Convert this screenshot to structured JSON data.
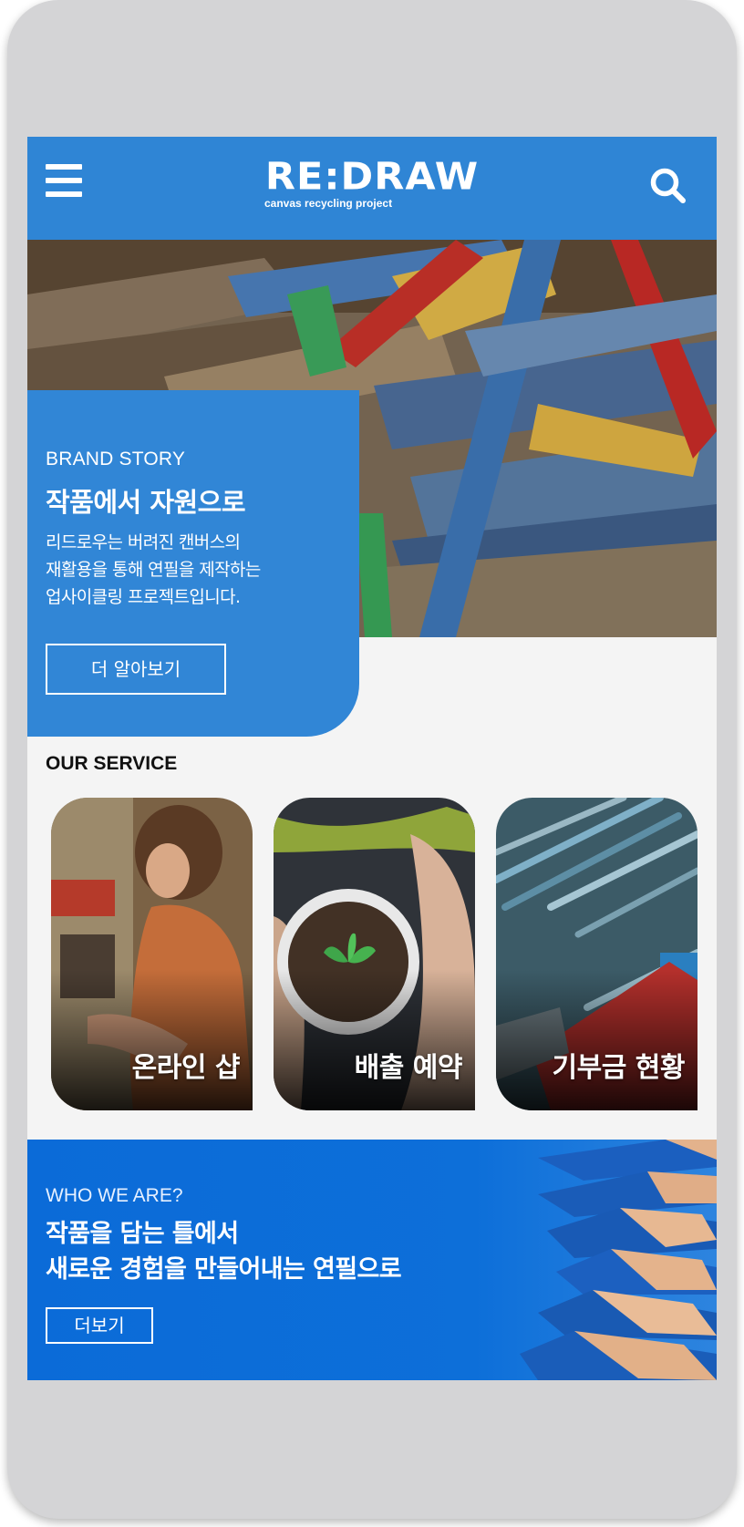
{
  "header": {
    "logo_main": "RE:DRAW",
    "logo_sub": "canvas recycling project",
    "colors": {
      "bar": "#2f85d5"
    }
  },
  "hero": {
    "kicker": "BRAND STORY",
    "title": "작품에서 자원으로",
    "description": [
      "리드로우는 버려진 캔버스의",
      "재활용을 통해 연필을 제작하는",
      "업사이클링 프로젝트입니다."
    ],
    "button_label": "더 알아보기",
    "image": "wood-frames-image"
  },
  "service": {
    "title": "OUR SERVICE",
    "cards": [
      {
        "label": "온라인 샵",
        "image": "artist-painting-image"
      },
      {
        "label": "배출 예약",
        "image": "sprout-in-cup-image"
      },
      {
        "label": "기부금 현황",
        "image": "colored-pencils-image"
      }
    ]
  },
  "who": {
    "kicker": "WHO WE ARE?",
    "title_lines": [
      "작품을 담는 틀에서",
      "새로운 경험을 만들어내는 연필으로"
    ],
    "button_label": "더보기",
    "image": "pencil-tips-image"
  }
}
